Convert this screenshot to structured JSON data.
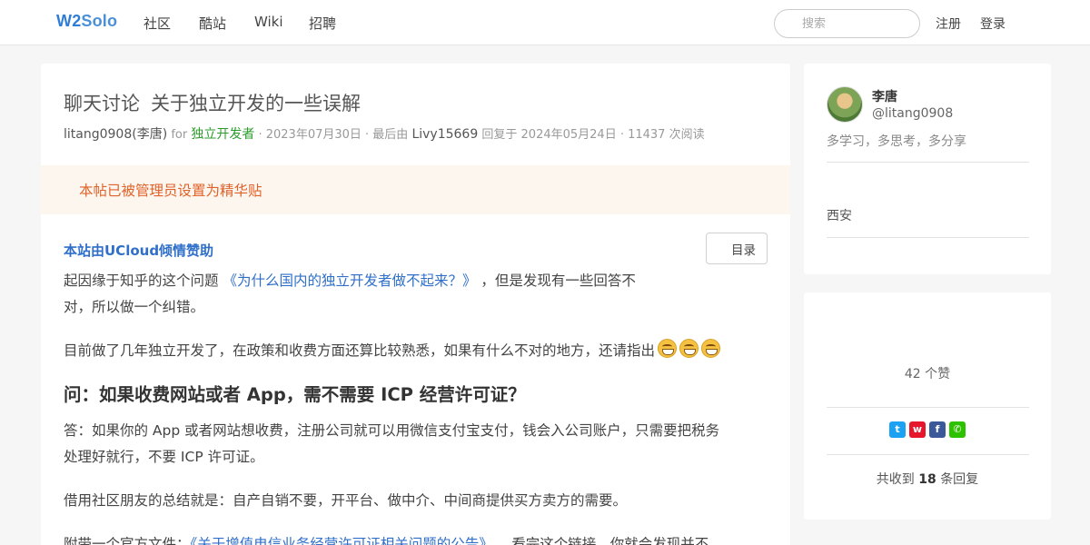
{
  "nav": {
    "logo_part1": "W2",
    "logo_part2": "Solo",
    "items": [
      "社区",
      "酷站",
      "Wiki",
      "招聘"
    ],
    "search_placeholder": "搜索",
    "register": "注册",
    "login": "登录"
  },
  "post": {
    "category": "聊天讨论",
    "title": "关于独立开发的一些误解",
    "meta": {
      "author": "litang0908(李唐)",
      "for_word": "for",
      "node": "独立开发者",
      "date": "· 2023年07月30日 · 最后由",
      "last_replier": "Livy15669",
      "reply_info": "回复于 2024年05月24日 · 11437 次阅读"
    },
    "notice": "本帖已被管理员设置为精华贴",
    "sponsor": "本站由UCloud倾情赞助",
    "toc_label": "目录",
    "p1_before": "起因缘于知乎的这个问题 ",
    "p1_link": "《为什么国内的独立开发者做不起来？》",
    "p1_after": " ，但是发现有一些回答不",
    "p1_line2": "对，所以做一个纠错。",
    "p2": "目前做了几年独立开发了，在政策和收费方面还算比较熟悉，如果有什么不对的地方，还请指出",
    "heading": "问：如果收费网站或者 App，需不需要 ICP 经营许可证？",
    "p3_line1": "答：如果你的 App 或者网站想收费，注册公司就可以用微信支付宝支付，钱会入公司账户，只需要把税务",
    "p3_line2": "处理好就行，不要 ICP 许可证。",
    "p4": "借用社区朋友的总结就是：自产自销不要，开平台、做中介、中间商提供买方卖方的需要。",
    "p5_before": "附带一个官方文件：",
    "p5_link": "《关于增值电信业务经营许可证相关问题的公告》",
    "p5_after": " ，看完这个链接，你就会发现并不"
  },
  "sidebar": {
    "author_name": "李唐",
    "author_handle": "@litang0908",
    "author_bio": "多学习，多思考，多分享",
    "author_location": "西安",
    "likes": "42 个赞",
    "replies_prefix": "共收到",
    "replies_count": "18",
    "replies_suffix": "条回复"
  },
  "colors": {
    "twitter": "#1da1f2",
    "weibo": "#e6162d",
    "facebook": "#3b5998",
    "wechat": "#2dc100"
  },
  "icons": [
    "twitter-icon",
    "weibo-icon",
    "facebook-icon",
    "wechat-icon",
    "search-icon",
    "emoji-grin-icon"
  ]
}
